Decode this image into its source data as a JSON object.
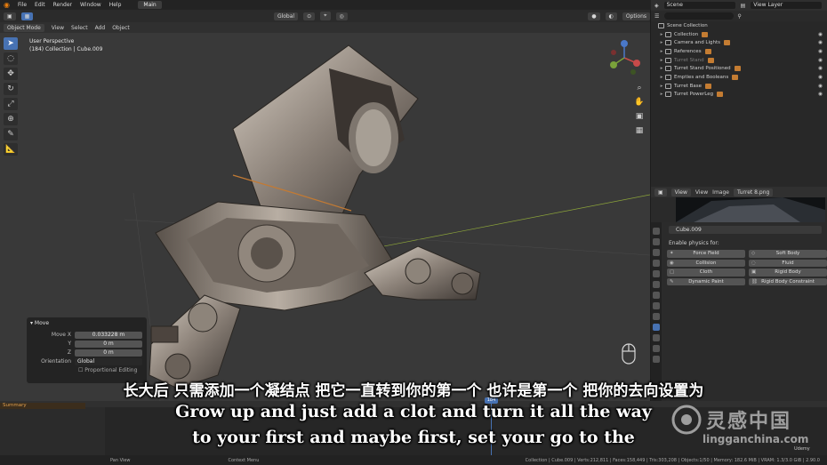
{
  "topbar": {
    "menus": [
      "File",
      "Edit",
      "Render",
      "Window",
      "Help"
    ],
    "workspace_tab": "Main"
  },
  "viewport_header": {
    "orientation": "Global",
    "options": "Options"
  },
  "tool_header": {
    "mode": "Object Mode",
    "menus": [
      "View",
      "Select",
      "Add",
      "Object"
    ]
  },
  "viewport_overlay": {
    "perspective": "User Perspective",
    "collection_info": "(184) Collection | Cube.009"
  },
  "move_panel": {
    "title": "Move",
    "move_x_label": "Move X",
    "move_x_value": "0.033228 m",
    "y_label": "Y",
    "y_value": "0 m",
    "z_label": "Z",
    "z_value": "0 m",
    "orientation_label": "Orientation",
    "orientation_value": "Global",
    "proportional": "Proportional Editing"
  },
  "outliner": {
    "scene": "Scene",
    "view_layer": "View Layer",
    "root": "Scene Collection",
    "items": [
      {
        "label": "Collection",
        "dim": false
      },
      {
        "label": "Camera and Lights",
        "dim": false
      },
      {
        "label": "References",
        "dim": false
      },
      {
        "label": "Turret Stand",
        "dim": true
      },
      {
        "label": "Turret Stand Positioned",
        "dim": false
      },
      {
        "label": "Empties and Booleans",
        "dim": false
      },
      {
        "label": "Turret Base",
        "dim": false
      },
      {
        "label": "Turret PowerLeg",
        "dim": false
      }
    ]
  },
  "image_editor": {
    "view": "View",
    "view_menu": "View",
    "image_menu": "Image",
    "image_name": "Turret 8.png"
  },
  "properties": {
    "object_name": "Cube.009",
    "section": "Enable physics for:",
    "buttons": [
      "Force Field",
      "Soft Body",
      "Collision",
      "Fluid",
      "Cloth",
      "Rigid Body",
      "Dynamic Paint",
      "Rigid Body Constraint"
    ]
  },
  "timeline": {
    "summary": "Summary",
    "current_frame": "184"
  },
  "statusbar": {
    "left": [
      "Pan View",
      "Context Menu"
    ],
    "right": "Collection | Cube.009 | Verts:212,811 | Faces:158,449 | Tris:303,208 | Objects:1/50 | Memory: 182.6 MiB | VRAM: 1.3/3.0 GiB | 2.90.0"
  },
  "subtitles": {
    "chinese": "长大后 只需添加一个凝结点 把它一直转到你的第一个 也许是第一个 把你的去向设置为",
    "english_line1": "Grow up and just add a clot and turn it all the way",
    "english_line2": "to your first and maybe first, set your go to the"
  },
  "watermark": {
    "cn": "灵感中国",
    "en": "lingganchina.com"
  },
  "udemy": "Udemy",
  "colors": {
    "accent": "#4772b3",
    "viewport_bg": "#393939",
    "panel_bg": "#282828",
    "summary": "#e0a050"
  }
}
